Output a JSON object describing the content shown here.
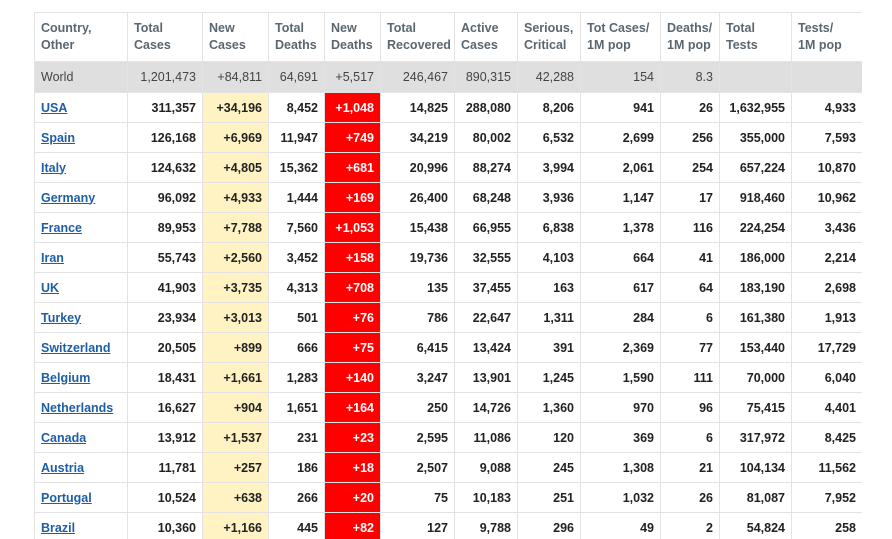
{
  "columns": [
    "Country,\nOther",
    "Total\nCases",
    "New\nCases",
    "Total\nDeaths",
    "New\nDeaths",
    "Total\nRecovered",
    "Active\nCases",
    "Serious,\nCritical",
    "Tot Cases/\n1M pop",
    "Deaths/\n1M pop",
    "Total\nTests",
    "Tests/\n1M pop"
  ],
  "world": [
    "World",
    "1,201,473",
    "+84,811",
    "64,691",
    "+5,517",
    "246,467",
    "890,315",
    "42,288",
    "154",
    "8.3",
    "",
    ""
  ],
  "rows": [
    [
      "USA",
      "311,357",
      "+34,196",
      "8,452",
      "+1,048",
      "14,825",
      "288,080",
      "8,206",
      "941",
      "26",
      "1,632,955",
      "4,933"
    ],
    [
      "Spain",
      "126,168",
      "+6,969",
      "11,947",
      "+749",
      "34,219",
      "80,002",
      "6,532",
      "2,699",
      "256",
      "355,000",
      "7,593"
    ],
    [
      "Italy",
      "124,632",
      "+4,805",
      "15,362",
      "+681",
      "20,996",
      "88,274",
      "3,994",
      "2,061",
      "254",
      "657,224",
      "10,870"
    ],
    [
      "Germany",
      "96,092",
      "+4,933",
      "1,444",
      "+169",
      "26,400",
      "68,248",
      "3,936",
      "1,147",
      "17",
      "918,460",
      "10,962"
    ],
    [
      "France",
      "89,953",
      "+7,788",
      "7,560",
      "+1,053",
      "15,438",
      "66,955",
      "6,838",
      "1,378",
      "116",
      "224,254",
      "3,436"
    ],
    [
      "Iran",
      "55,743",
      "+2,560",
      "3,452",
      "+158",
      "19,736",
      "32,555",
      "4,103",
      "664",
      "41",
      "186,000",
      "2,214"
    ],
    [
      "UK",
      "41,903",
      "+3,735",
      "4,313",
      "+708",
      "135",
      "37,455",
      "163",
      "617",
      "64",
      "183,190",
      "2,698"
    ],
    [
      "Turkey",
      "23,934",
      "+3,013",
      "501",
      "+76",
      "786",
      "22,647",
      "1,311",
      "284",
      "6",
      "161,380",
      "1,913"
    ],
    [
      "Switzerland",
      "20,505",
      "+899",
      "666",
      "+75",
      "6,415",
      "13,424",
      "391",
      "2,369",
      "77",
      "153,440",
      "17,729"
    ],
    [
      "Belgium",
      "18,431",
      "+1,661",
      "1,283",
      "+140",
      "3,247",
      "13,901",
      "1,245",
      "1,590",
      "111",
      "70,000",
      "6,040"
    ],
    [
      "Netherlands",
      "16,627",
      "+904",
      "1,651",
      "+164",
      "250",
      "14,726",
      "1,360",
      "970",
      "96",
      "75,415",
      "4,401"
    ],
    [
      "Canada",
      "13,912",
      "+1,537",
      "231",
      "+23",
      "2,595",
      "11,086",
      "120",
      "369",
      "6",
      "317,972",
      "8,425"
    ],
    [
      "Austria",
      "11,781",
      "+257",
      "186",
      "+18",
      "2,507",
      "9,088",
      "245",
      "1,308",
      "21",
      "104,134",
      "11,562"
    ],
    [
      "Portugal",
      "10,524",
      "+638",
      "266",
      "+20",
      "75",
      "10,183",
      "251",
      "1,032",
      "26",
      "81,087",
      "7,952"
    ],
    [
      "Brazil",
      "10,360",
      "+1,166",
      "445",
      "+82",
      "127",
      "9,788",
      "296",
      "49",
      "2",
      "54,824",
      "258"
    ]
  ]
}
